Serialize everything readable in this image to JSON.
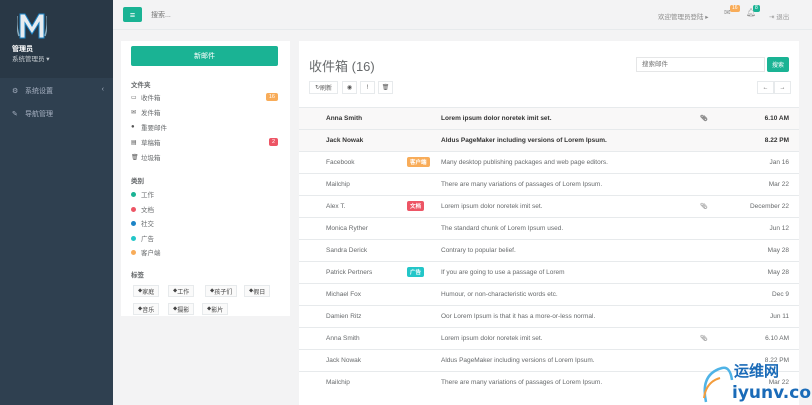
{
  "sidebar": {
    "profile_name": "管理员",
    "profile_role": "系统管理员 ▾",
    "items": [
      {
        "label": "系统设置",
        "icon": "gear-icon"
      },
      {
        "label": "导航管理",
        "icon": "wrench-icon"
      }
    ]
  },
  "topbar": {
    "search_placeholder": "搜索...",
    "welcome": "欢迎管理员登陆 ▸",
    "mail_count": "16",
    "bell_count": "8",
    "logout": "退出"
  },
  "left": {
    "compose_label": "新邮件",
    "folders_title": "文件夹",
    "folders": [
      {
        "label": "收件箱",
        "count": "16",
        "count_color": "#f8ac59",
        "icon": "inbox-icon"
      },
      {
        "label": "发件箱",
        "count": "",
        "icon": "envelope-icon"
      },
      {
        "label": "重要邮件",
        "count": "",
        "icon": "certificate-icon"
      },
      {
        "label": "草稿箱",
        "count": "2",
        "count_color": "#ed5565",
        "icon": "file-icon"
      },
      {
        "label": "垃圾箱",
        "count": "",
        "icon": "trash-icon"
      }
    ],
    "categories_title": "类别",
    "categories": [
      {
        "label": "工作",
        "color": "#1ab394"
      },
      {
        "label": "文档",
        "color": "#ed5565"
      },
      {
        "label": "社交",
        "color": "#1c84c6"
      },
      {
        "label": "广告",
        "color": "#23c6c8"
      },
      {
        "label": "客户端",
        "color": "#f8ac59"
      }
    ],
    "tags_title": "标签",
    "tags": [
      "家庭",
      "工作",
      "孩子们",
      "假日",
      "音乐",
      "摄影",
      "影片"
    ]
  },
  "main": {
    "title": "收件箱 (16)",
    "search_placeholder": "搜索邮件",
    "search_button": "搜索",
    "refresh_label": "刷新",
    "emails": [
      {
        "from": "Anna Smith",
        "label": "",
        "subject": "Lorem ipsum dolor noretek imit set.",
        "clip": true,
        "date": "6.10 AM",
        "unread": true
      },
      {
        "from": "Jack Nowak",
        "label": "",
        "subject": "Aldus PageMaker including versions of Lorem Ipsum.",
        "clip": false,
        "date": "8.22 PM",
        "unread": true
      },
      {
        "from": "Facebook",
        "label": "客户端",
        "label_color": "#f8ac59",
        "subject": "Many desktop publishing packages and web page editors.",
        "clip": false,
        "date": "Jan 16",
        "unread": false
      },
      {
        "from": "Mailchip",
        "label": "",
        "subject": "There are many variations of passages of Lorem Ipsum.",
        "clip": false,
        "date": "Mar 22",
        "unread": false
      },
      {
        "from": "Alex T.",
        "label": "文档",
        "label_color": "#ed5565",
        "subject": "Lorem ipsum dolor noretek imit set.",
        "clip": true,
        "date": "December 22",
        "unread": false
      },
      {
        "from": "Monica Ryther",
        "label": "",
        "subject": "The standard chunk of Lorem Ipsum used.",
        "clip": false,
        "date": "Jun 12",
        "unread": false
      },
      {
        "from": "Sandra Derick",
        "label": "",
        "subject": "Contrary to popular belief.",
        "clip": false,
        "date": "May 28",
        "unread": false
      },
      {
        "from": "Patrick Pertners",
        "label": "广告",
        "label_color": "#23c6c8",
        "subject": "If you are going to use a passage of Lorem",
        "clip": false,
        "date": "May 28",
        "unread": false
      },
      {
        "from": "Michael Fox",
        "label": "",
        "subject": "Humour, or non-characteristic words etc.",
        "clip": false,
        "date": "Dec 9",
        "unread": false
      },
      {
        "from": "Damien Ritz",
        "label": "",
        "subject": "Oor Lorem Ipsum is that it has a more-or-less normal.",
        "clip": false,
        "date": "Jun 11",
        "unread": false
      },
      {
        "from": "Anna Smith",
        "label": "",
        "subject": "Lorem ipsum dolor noretek imit set.",
        "clip": true,
        "date": "6.10 AM",
        "unread": false
      },
      {
        "from": "Jack Nowak",
        "label": "",
        "subject": "Aldus PageMaker including versions of Lorem Ipsum.",
        "clip": false,
        "date": "8.22 PM",
        "unread": false
      },
      {
        "from": "Mailchip",
        "label": "",
        "subject": "There are many variations of passages of Lorem Ipsum.",
        "clip": false,
        "date": "Mar 22",
        "unread": false
      }
    ]
  },
  "watermark": {
    "cn": "运维网",
    "url": "iyunv.com"
  }
}
